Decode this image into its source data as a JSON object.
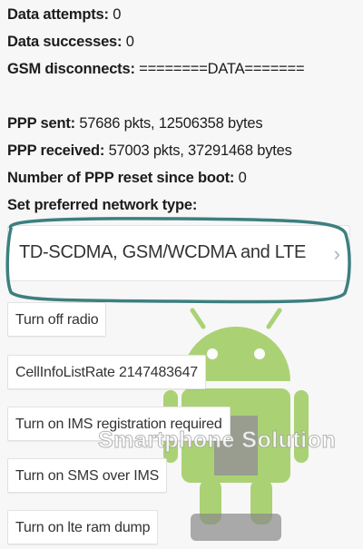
{
  "info": {
    "data_attempts": {
      "label": "Data attempts:",
      "value": "0"
    },
    "data_successes": {
      "label": "Data successes:",
      "value": "0"
    },
    "gsm_disconnects": {
      "label": "GSM disconnects:",
      "value": "========DATA======="
    },
    "ppp_sent": {
      "label": "PPP sent:",
      "value": "57686 pkts, 12506358 bytes"
    },
    "ppp_received": {
      "label": "PPP received:",
      "value": "57003 pkts, 37291468 bytes"
    },
    "ppp_reset": {
      "label": "Number of PPP reset since boot:",
      "value": "0"
    },
    "preferred_network_label": "Set preferred network type:"
  },
  "network_type": {
    "selected": "TD-SCDMA, GSM/WCDMA and LTE",
    "chevron": "chevron-right-icon"
  },
  "buttons": {
    "radio": "Turn off radio",
    "cellinfo": "CellInfoListRate 2147483647",
    "ims_registration": "Turn on IMS registration required",
    "sms_over_ims": "Turn on SMS over IMS",
    "lte_ram_dump": "Turn on lte ram dump"
  },
  "watermark": {
    "text": "Smartphone Solution",
    "logo": "android-robot-logo"
  },
  "colors": {
    "highlight": "#3d7f7f",
    "android_green": "#8cc13f"
  }
}
